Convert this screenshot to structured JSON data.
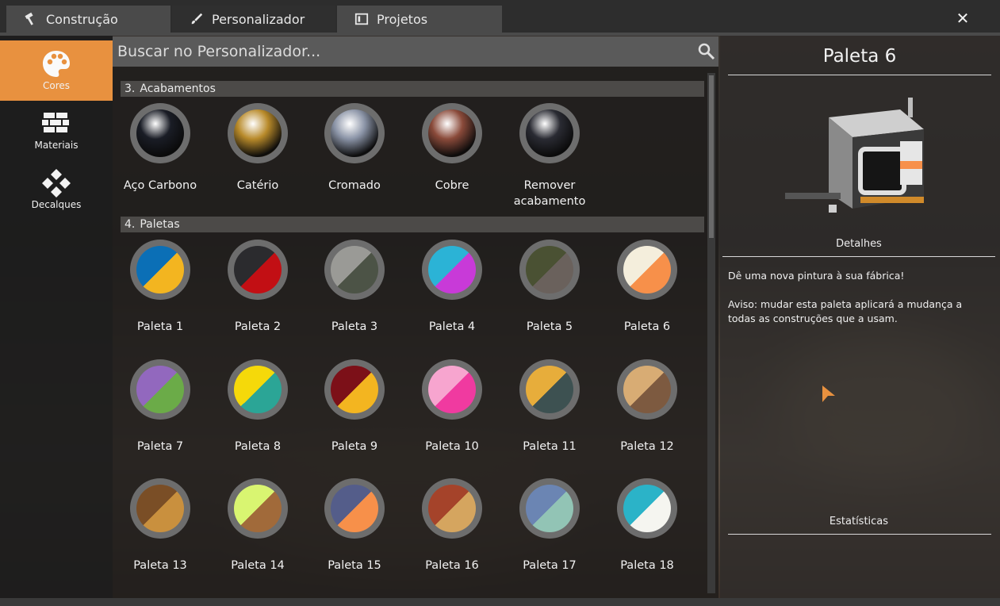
{
  "tabs": [
    {
      "label": "Construção",
      "icon": "hammer-icon"
    },
    {
      "label": "Personalizador",
      "icon": "brush-icon"
    },
    {
      "label": "Projetos",
      "icon": "blueprint-icon"
    }
  ],
  "close_label": "✕",
  "sidebar": {
    "items": [
      {
        "label": "Cores",
        "icon": "palette-icon",
        "active": true
      },
      {
        "label": "Materiais",
        "icon": "bricks-icon",
        "active": false
      },
      {
        "label": "Decalques",
        "icon": "decal-icon",
        "active": false
      }
    ]
  },
  "search": {
    "placeholder": "Buscar no Personalizador..."
  },
  "sections": {
    "finishes": {
      "number": "3.",
      "title": "Acabamentos",
      "items": [
        {
          "label": "Aço Carbono",
          "color": "#1a1d26"
        },
        {
          "label": "Catério",
          "color": "#b88a2a"
        },
        {
          "label": "Cromado",
          "color": "#8a93a6"
        },
        {
          "label": "Cobre",
          "color": "#8a4a3a"
        },
        {
          "label": "Remover acabamento",
          "color": "#2a2b33"
        }
      ]
    },
    "palettes": {
      "number": "4.",
      "title": "Paletas",
      "items": [
        {
          "label": "Paleta 1",
          "c1": "#0b6fb6",
          "c2": "#f3b520"
        },
        {
          "label": "Paleta 2",
          "c1": "#2b2b2e",
          "c2": "#c20f14"
        },
        {
          "label": "Paleta 3",
          "c1": "#9a9a96",
          "c2": "#4c5346"
        },
        {
          "label": "Paleta 4",
          "c1": "#2bb3d6",
          "c2": "#c83ad8"
        },
        {
          "label": "Paleta 5",
          "c1": "#4a5133",
          "c2": "#6a615c"
        },
        {
          "label": "Paleta 6",
          "c1": "#f4eedc",
          "c2": "#f7904a"
        },
        {
          "label": "Paleta 7",
          "c1": "#9268be",
          "c2": "#6bab48"
        },
        {
          "label": "Paleta 8",
          "c1": "#f5d90a",
          "c2": "#2ba596"
        },
        {
          "label": "Paleta 9",
          "c1": "#7c1018",
          "c2": "#f3b520"
        },
        {
          "label": "Paleta 10",
          "c1": "#f7a5cf",
          "c2": "#f03aa0"
        },
        {
          "label": "Paleta 11",
          "c1": "#e7ad3b",
          "c2": "#3d5151"
        },
        {
          "label": "Paleta 12",
          "c1": "#d8ac74",
          "c2": "#7d5a40"
        },
        {
          "label": "Paleta 13",
          "c1": "#7a4e26",
          "c2": "#c9903e"
        },
        {
          "label": "Paleta 14",
          "c1": "#d9f571",
          "c2": "#a16a3a"
        },
        {
          "label": "Paleta 15",
          "c1": "#545d8a",
          "c2": "#f7904a"
        },
        {
          "label": "Paleta 16",
          "c1": "#a5432a",
          "c2": "#d5a55f"
        },
        {
          "label": "Paleta 17",
          "c1": "#6b85b3",
          "c2": "#92c4b5"
        },
        {
          "label": "Paleta 18",
          "c1": "#2bb3c8",
          "c2": "#f5f5f0"
        }
      ]
    }
  },
  "detail": {
    "title": "Paleta 6",
    "details_label": "Detalhes",
    "description": "Dê uma nova pintura à sua fábrica!",
    "warning": "Aviso: mudar esta paleta aplicará a mudança a todas as construções que a usam.",
    "stats_label": "Estatísticas"
  },
  "colors": {
    "accent": "#e8913f"
  }
}
